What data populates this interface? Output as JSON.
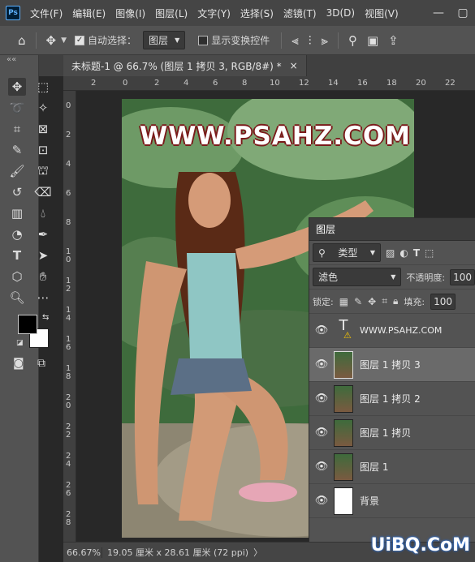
{
  "app": {
    "logo": "Ps"
  },
  "menu": [
    "文件(F)",
    "编辑(E)",
    "图像(I)",
    "图层(L)",
    "文字(Y)",
    "选择(S)",
    "滤镜(T)",
    "3D(D)",
    "视图(V)"
  ],
  "window_buttons": [
    "—",
    "▢",
    "✕"
  ],
  "options_bar": {
    "auto_select_label": "自动选择：",
    "auto_select_checked": true,
    "auto_select_target": "图层",
    "transform_controls_label": "显示变换控件",
    "transform_controls_checked": false
  },
  "toolbar": {
    "collapse": "««"
  },
  "document_tab": {
    "title": "未标题-1 @ 66.7% (图层 1 拷贝 3, RGB/8#) *",
    "close": "×"
  },
  "ruler_h_ticks": [
    "2",
    "0",
    "2",
    "4",
    "6",
    "8",
    "10",
    "12",
    "14",
    "16",
    "18",
    "20",
    "22"
  ],
  "ruler_v_ticks": [
    "0",
    "2",
    "4",
    "6",
    "8",
    "1 0",
    "1 2",
    "1 4",
    "1 6",
    "1 8",
    "2 0",
    "2 2",
    "2 4",
    "2 6",
    "2 8"
  ],
  "canvas_text": "WWW.PSAHZ.COM",
  "statusbar": {
    "zoom": "66.67%",
    "info": "19.05 厘米 x 28.61 厘米 (72 ppi)",
    "arrow": "〉"
  },
  "layers_panel": {
    "title": "图层",
    "filter_label": "类型",
    "blend_mode": "滤色",
    "opacity_label": "不透明度:",
    "opacity_value": "100",
    "lock_label": "锁定:",
    "fill_label": "填充:",
    "fill_value": "100",
    "layers": [
      {
        "name": "WWW.PSAHZ.COM",
        "kind": "text",
        "selected": false
      },
      {
        "name": "图层 1 拷贝 3",
        "kind": "image",
        "selected": true
      },
      {
        "name": "图层 1 拷贝 2",
        "kind": "image",
        "selected": false
      },
      {
        "name": "图层 1 拷贝",
        "kind": "image",
        "selected": false
      },
      {
        "name": "图层 1",
        "kind": "image",
        "selected": false
      },
      {
        "name": "背景",
        "kind": "white",
        "selected": false
      }
    ]
  },
  "watermark": "UiBQ.CoM"
}
